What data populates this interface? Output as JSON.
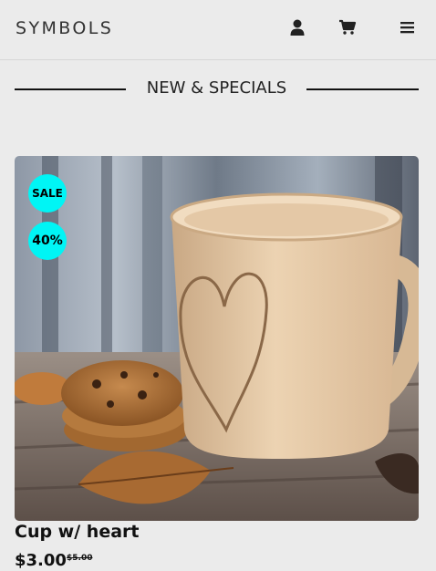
{
  "header": {
    "brand": "SYMBOLS",
    "icons": [
      "user-icon",
      "cart-icon",
      "hamburger-menu-icon"
    ]
  },
  "section": {
    "title": "NEW & SPECIALS"
  },
  "product": {
    "name": "Cup w/ heart",
    "price": "$3.00",
    "old_price": "$5.00",
    "badges": {
      "sale": "SALE",
      "discount": "40%"
    },
    "image": "coffee-mug-with-heart-and-cookies"
  },
  "colors": {
    "background": "#ebebeb",
    "badge": "#00f5f5",
    "text": "#111111"
  }
}
